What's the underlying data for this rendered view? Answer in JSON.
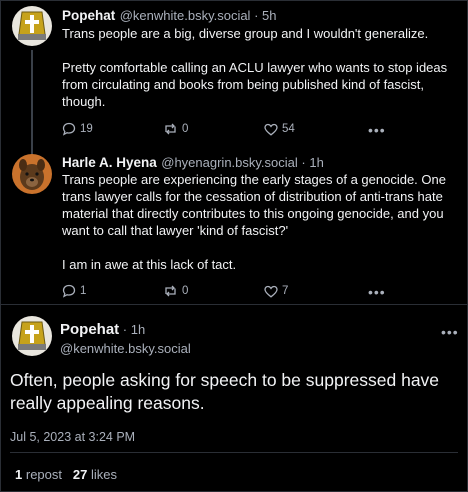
{
  "posts": [
    {
      "name": "Popehat",
      "handle": "@kenwhite.bsky.social",
      "time": "5h",
      "text": "Trans people are a big, diverse group and I wouldn't generalize.\n\nPretty comfortable calling an ACLU lawyer who wants to stop ideas from circulating and books from being published kind of fascist, though.",
      "replies": "19",
      "reposts": "0",
      "likes": "54",
      "more": "•••"
    },
    {
      "name": "Harle A. Hyena",
      "handle": "@hyenagrin.bsky.social",
      "time": "1h",
      "text": "Trans people are experiencing the early stages of a genocide. One trans lawyer calls for the cessation of distribution of anti-trans hate material that directly contributes to this ongoing genocide, and you want to call that lawyer 'kind of fascist?'\n\nI am in awe at this lack of tact.",
      "replies": "1",
      "reposts": "0",
      "likes": "7",
      "more": "•••"
    }
  ],
  "focus_post": {
    "name": "Popehat",
    "time": "1h",
    "handle": "@kenwhite.bsky.social",
    "text": "Often, people asking for speech to be suppressed have really appealing reasons.",
    "timestamp": "Jul 5, 2023 at 3:24 PM",
    "repost_count": "1",
    "repost_label": "repost",
    "like_count": "27",
    "like_label": "likes",
    "more": "•••"
  },
  "separator": " · ",
  "colors": {
    "background": "#000000",
    "text": "#f2f3f5",
    "muted": "#aab0bb",
    "divider": "#2a2e35"
  },
  "icons": [
    "reply-icon",
    "repost-icon",
    "like-icon",
    "more-icon"
  ]
}
